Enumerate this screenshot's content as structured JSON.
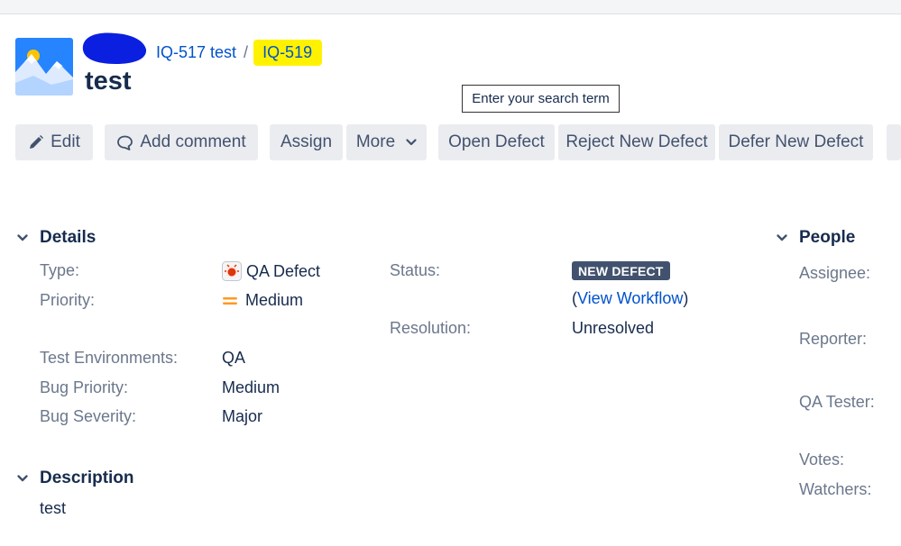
{
  "breadcrumb": {
    "parent_issue": "IQ-517 test",
    "separator": "/",
    "current_issue": "IQ-519"
  },
  "issue": {
    "title": "test"
  },
  "tooltip": {
    "text": "Enter your search term"
  },
  "toolbar": {
    "edit": "Edit",
    "add_comment": "Add comment",
    "assign": "Assign",
    "more": "More",
    "open_defect": "Open Defect",
    "reject_new_defect": "Reject New Defect",
    "defer_new_defect": "Defer New Defect"
  },
  "details": {
    "heading": "Details",
    "type_label": "Type:",
    "type_value": "QA Defect",
    "priority_label": "Priority:",
    "priority_value": "Medium",
    "status_label": "Status:",
    "status_value": "NEW DEFECT",
    "workflow_open": "(",
    "workflow_link": "View Workflow",
    "workflow_close": ")",
    "resolution_label": "Resolution:",
    "resolution_value": "Unresolved",
    "test_env_label": "Test Environments:",
    "test_env_value": "QA",
    "bug_priority_label": "Bug Priority:",
    "bug_priority_value": "Medium",
    "bug_severity_label": "Bug Severity:",
    "bug_severity_value": "Major"
  },
  "description": {
    "heading": "Description",
    "text": "test"
  },
  "people": {
    "heading": "People",
    "assignee_label": "Assignee:",
    "reporter_label": "Reporter:",
    "qa_tester_label": "QA Tester:",
    "votes_label": "Votes:",
    "watchers_label": "Watchers:"
  },
  "colors": {
    "link": "#0052cc",
    "highlight": "#fff200",
    "redaction": "#0a1fe0",
    "status_lozenge": "#42526e",
    "priority_medium": "#ff991f"
  }
}
